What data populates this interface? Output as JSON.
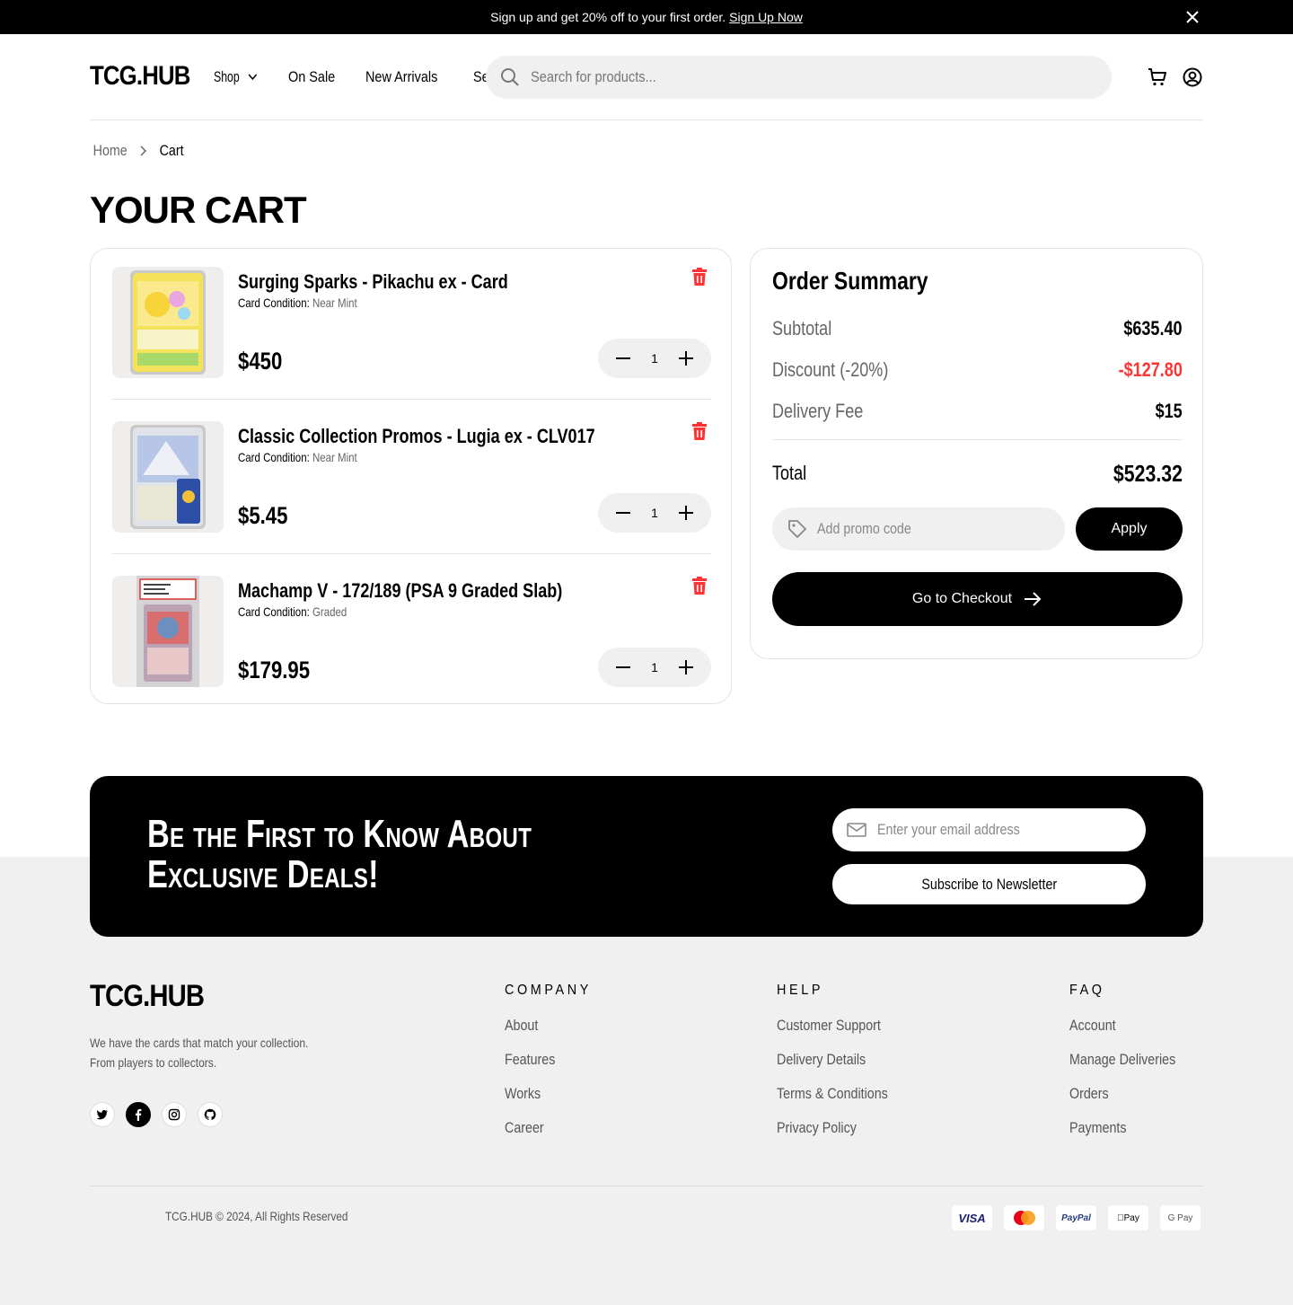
{
  "promo_bar": {
    "text": "Sign up and get 20% off to your first order.",
    "link": "Sign Up Now"
  },
  "header": {
    "logo": "TCG.HUB",
    "nav": [
      "Shop",
      "On Sale",
      "New Arrivals",
      "Sets"
    ],
    "search_placeholder": "Search for products..."
  },
  "breadcrumb": {
    "home": "Home",
    "current": "Cart"
  },
  "page_title": "YOUR CART",
  "cart": {
    "condition_label": "Card Condition:",
    "items": [
      {
        "name": "Surging Sparks - Pikachu ex - Card",
        "condition": "Near Mint",
        "price": "$450",
        "qty": "1"
      },
      {
        "name": "Classic Collection Promos - Lugia ex - CLV017",
        "condition": "Near Mint",
        "price": "$5.45",
        "qty": "1"
      },
      {
        "name": "Machamp V - 172/189 (PSA 9 Graded Slab)",
        "condition": "Graded",
        "price": "$179.95",
        "qty": "1"
      }
    ]
  },
  "summary": {
    "title": "Order Summary",
    "subtotal_label": "Subtotal",
    "subtotal": "$635.40",
    "discount_label": "Discount (-20%)",
    "discount": "-$127.80",
    "delivery_label": "Delivery Fee",
    "delivery": "$15",
    "total_label": "Total",
    "total": "$523.32",
    "promo_placeholder": "Add promo code",
    "apply": "Apply",
    "checkout": "Go to Checkout"
  },
  "newsletter": {
    "title": "Be the First to Know About Exclusive Deals!",
    "email_placeholder": "Enter your email address",
    "subscribe": "Subscribe to Newsletter"
  },
  "footer": {
    "logo": "TCG.HUB",
    "tagline_1": "We have the cards that match your collection.",
    "tagline_2": "From players to collectors.",
    "company": {
      "heading": "COMPANY",
      "links": [
        "About",
        "Features",
        "Works",
        "Career"
      ]
    },
    "help": {
      "heading": "HELP",
      "links": [
        "Customer Support",
        "Delivery Details",
        "Terms & Conditions",
        "Privacy Policy"
      ]
    },
    "faq": {
      "heading": "FAQ",
      "links": [
        "Account",
        "Manage Deliveries",
        "Orders",
        "Payments"
      ]
    },
    "copyright": "TCG.HUB © 2024, All Rights Reserved",
    "payments": [
      "VISA",
      "Mastercard",
      "PayPal",
      "Apple Pay",
      "G Pay"
    ]
  },
  "colors": {
    "accent": "#000000",
    "danger": "#ff3333",
    "muted": "#f0f0f0"
  }
}
